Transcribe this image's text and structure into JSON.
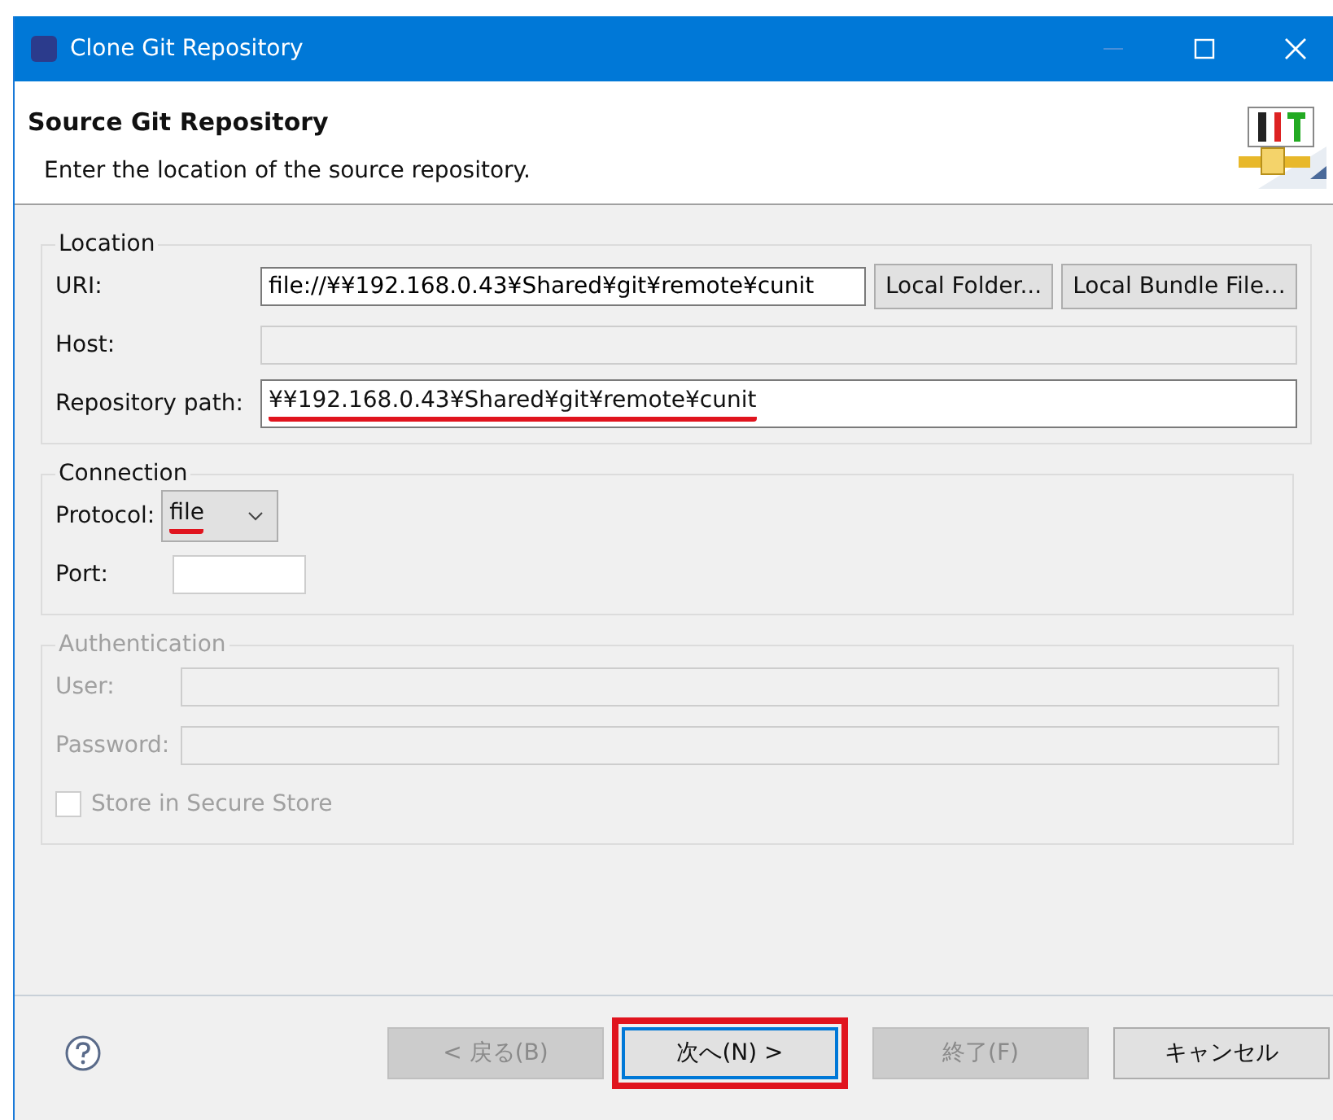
{
  "window": {
    "title": "Clone Git Repository"
  },
  "header": {
    "title": "Source Git Repository",
    "description": "Enter the location of the source repository."
  },
  "location": {
    "legend": "Location",
    "uri": {
      "label": "URI:",
      "value": "file://¥¥192.168.0.43¥Shared¥git¥remote¥cunit"
    },
    "buttons": [
      "Local Folder...",
      "Local Bundle File..."
    ],
    "host": {
      "label": "Host:"
    },
    "path": {
      "label": "Repository path:",
      "value": "¥¥192.168.0.43¥Shared¥git¥remote¥cunit",
      "underlined": true
    }
  },
  "connection": {
    "legend": "Connection",
    "protocol": {
      "label": "Protocol:",
      "value": "file",
      "underlined": true
    },
    "port": {
      "label": "Port:"
    }
  },
  "authentication": {
    "legend": "Authentication",
    "disabled": true,
    "user": {
      "label": "User:"
    },
    "password": {
      "label": "Password:"
    },
    "store": {
      "label": "Store in Secure Store",
      "checked": false
    }
  },
  "buttons": [
    {
      "label": "< 戻る(B)",
      "disabled": true,
      "default": false,
      "highlighted": false
    },
    {
      "label": "次へ(N) >",
      "disabled": false,
      "default": true,
      "highlighted": true
    },
    {
      "label": "終了(F)",
      "disabled": true,
      "default": false,
      "highlighted": false
    },
    {
      "label": "キャンセル",
      "disabled": false,
      "default": false,
      "highlighted": false
    }
  ]
}
